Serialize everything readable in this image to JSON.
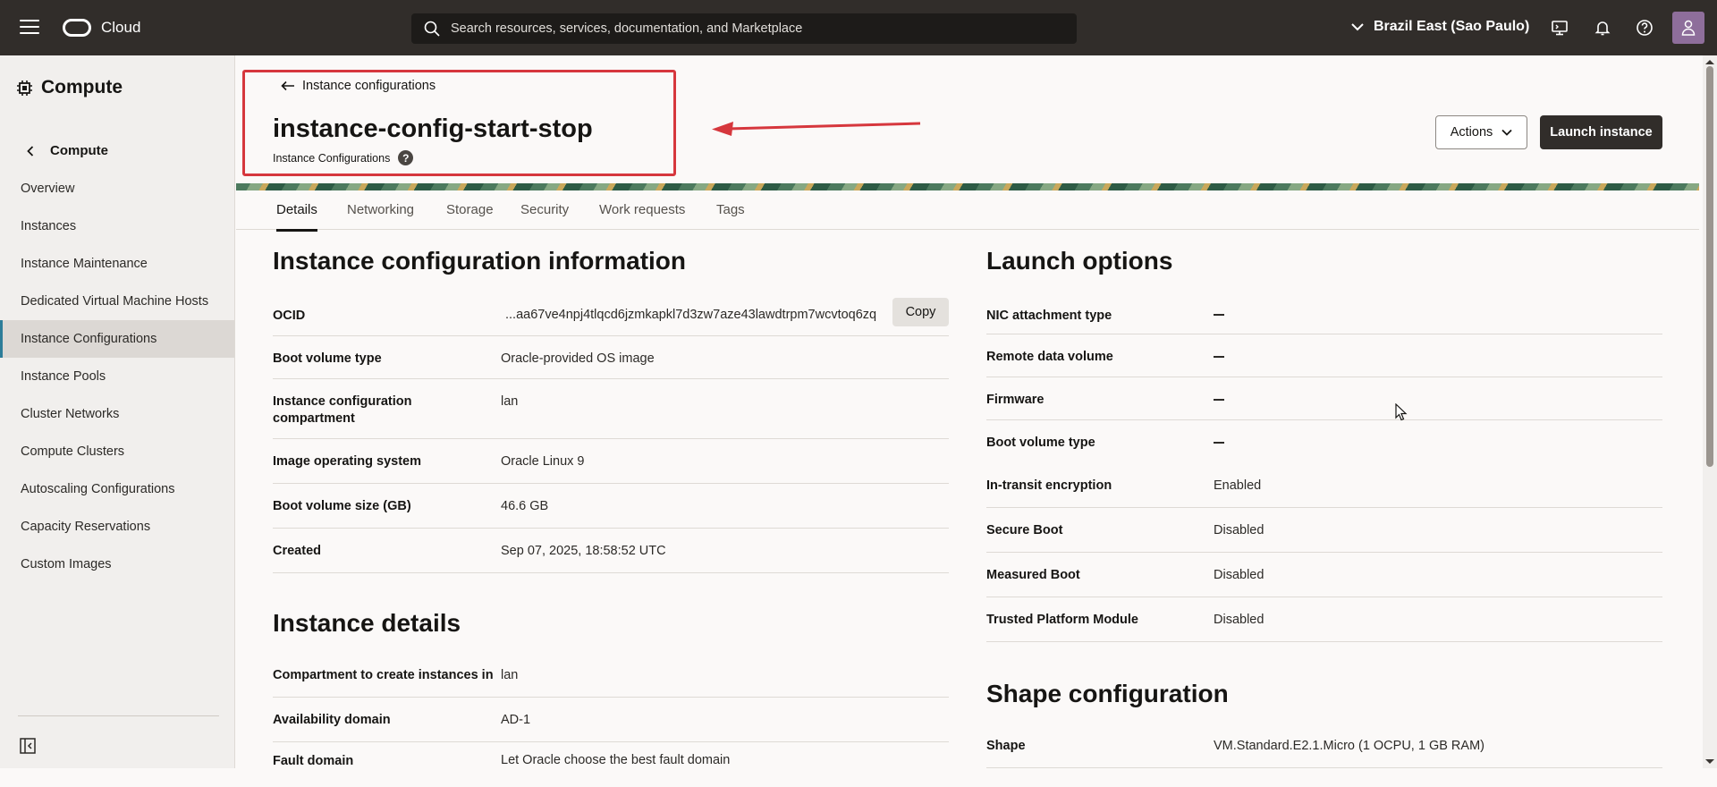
{
  "topbar": {
    "brand": "Cloud",
    "search_placeholder": "Search resources, services, documentation, and Marketplace",
    "region": "Brazil East (Sao Paulo)"
  },
  "sidebar": {
    "title": "Compute",
    "back_label": "Compute",
    "items": [
      {
        "label": "Overview"
      },
      {
        "label": "Instances"
      },
      {
        "label": "Instance Maintenance"
      },
      {
        "label": "Dedicated Virtual Machine Hosts"
      },
      {
        "label": "Instance Configurations"
      },
      {
        "label": "Instance Pools"
      },
      {
        "label": "Cluster Networks"
      },
      {
        "label": "Compute Clusters"
      },
      {
        "label": "Autoscaling Configurations"
      },
      {
        "label": "Capacity Reservations"
      },
      {
        "label": "Custom Images"
      }
    ]
  },
  "header": {
    "back_link": "Instance configurations",
    "title": "instance-config-start-stop",
    "subtitle": "Instance Configurations",
    "help": "?",
    "actions_label": "Actions",
    "launch_label": "Launch instance"
  },
  "tabs": [
    "Details",
    "Networking",
    "Storage",
    "Security",
    "Work requests",
    "Tags"
  ],
  "info": {
    "title": "Instance configuration information",
    "ocid_label": "OCID",
    "ocid_value": "...aa67ve4npj4tlqcd6jzmkapkl7d3zw7aze43lawdtrpm7wcvtoq6zq",
    "copy_label": "Copy",
    "rows": [
      {
        "label": "Boot volume type",
        "value": "Oracle-provided OS image"
      },
      {
        "label": "Instance configuration compartment",
        "value": "lan"
      },
      {
        "label": "Image operating system",
        "value": "Oracle Linux 9"
      },
      {
        "label": "Boot volume size (GB)",
        "value": "46.6 GB"
      },
      {
        "label": "Created",
        "value": "Sep 07, 2025, 18:58:52 UTC"
      }
    ]
  },
  "details": {
    "title": "Instance details",
    "rows": [
      {
        "label": "Compartment to create instances in",
        "value": "lan"
      },
      {
        "label": "Availability domain",
        "value": "AD-1"
      },
      {
        "label": "Fault domain",
        "value": "Let Oracle choose the best fault domain"
      }
    ]
  },
  "launch": {
    "title": "Launch options",
    "rows": [
      {
        "label": "NIC attachment type",
        "value": ""
      },
      {
        "label": "Remote data volume",
        "value": ""
      },
      {
        "label": "Firmware",
        "value": ""
      },
      {
        "label": "Boot volume type",
        "value": ""
      },
      {
        "label": "In-transit encryption",
        "value": "Enabled"
      },
      {
        "label": "Secure Boot",
        "value": "Disabled"
      },
      {
        "label": "Measured Boot",
        "value": "Disabled"
      },
      {
        "label": "Trusted Platform Module",
        "value": "Disabled"
      }
    ]
  },
  "shape": {
    "title": "Shape configuration",
    "shape_label": "Shape",
    "shape_value": "VM.Standard.E2.1.Micro (1 OCPU, 1 GB RAM)"
  },
  "colors": {
    "accent": "#2d7d99",
    "annotation": "#d6373d",
    "topbar": "#312d2a"
  }
}
